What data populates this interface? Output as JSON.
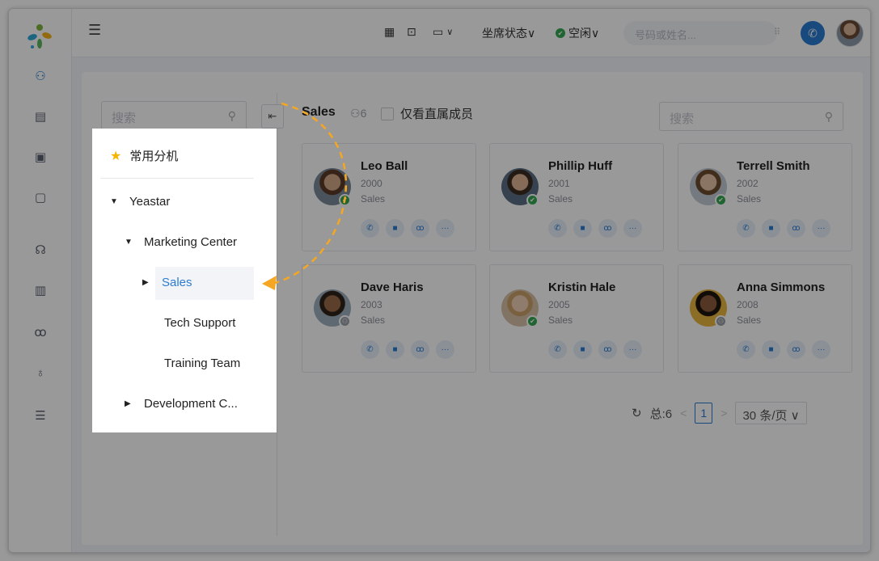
{
  "sidebar": {
    "icons": [
      {
        "name": "contacts-icon",
        "glyph": "⚇",
        "active": true
      },
      {
        "name": "phonebook-icon",
        "glyph": "▤"
      },
      {
        "name": "monitor-icon",
        "glyph": "▣"
      },
      {
        "name": "screen-icon",
        "glyph": "▢"
      },
      {
        "name": "headset-icon",
        "glyph": "☊"
      },
      {
        "name": "document-icon",
        "glyph": "▥"
      },
      {
        "name": "voicemail-icon",
        "glyph": "ꝏ"
      },
      {
        "name": "microphone-icon",
        "glyph": "♁"
      },
      {
        "name": "settings-list-icon",
        "glyph": "☰"
      }
    ]
  },
  "topbar": {
    "agent_status": "坐席状态∨",
    "presence": "空闲∨",
    "search_placeholder": "号码或姓名...",
    "dialpad": "⠿"
  },
  "tree": {
    "search_placeholder": "搜索",
    "favorites": "常用分机",
    "root": "Yeastar",
    "marketing": "Marketing Center",
    "sales": "Sales",
    "tech": "Tech Support",
    "training": "Training Team",
    "development": "Development C..."
  },
  "group": {
    "title": "Sales",
    "count": "6",
    "direct_only": "仅看直属成员",
    "search_placeholder": "搜索"
  },
  "members": [
    {
      "name": "Leo Ball",
      "ext": "2000",
      "dept": "Sales",
      "status": "online",
      "avatar": [
        "#d3a888",
        "#5a3a25",
        "#7c8b98"
      ]
    },
    {
      "name": "Phillip Huff",
      "ext": "2001",
      "dept": "Sales",
      "status": "online",
      "avatar": [
        "#e0b393",
        "#3d2c22",
        "#5a6e85"
      ]
    },
    {
      "name": "Terrell Smith",
      "ext": "2002",
      "dept": "Sales",
      "status": "online",
      "avatar": [
        "#e6c2a7",
        "#6b4b2d",
        "#c3ccd6"
      ]
    },
    {
      "name": "Dave Haris",
      "ext": "2003",
      "dept": "Sales",
      "status": "offline",
      "avatar": [
        "#9a6b4a",
        "#2f2219",
        "#9fb0bf"
      ]
    },
    {
      "name": "Kristin Hale",
      "ext": "2005",
      "dept": "Sales",
      "status": "online",
      "avatar": [
        "#efcfb5",
        "#caa06a",
        "#d8c2a8"
      ]
    },
    {
      "name": "Anna Simmons",
      "ext": "2008",
      "dept": "Sales",
      "status": "offline",
      "avatar": [
        "#8a5a3c",
        "#1f1510",
        "#e9b640"
      ]
    }
  ],
  "pager": {
    "total": "总:6",
    "page": "1",
    "page_size": "30 条/页 ∨"
  },
  "colors": {
    "accent": "#2b7cd3",
    "online": "#34a853",
    "callout": "#f5a623"
  }
}
